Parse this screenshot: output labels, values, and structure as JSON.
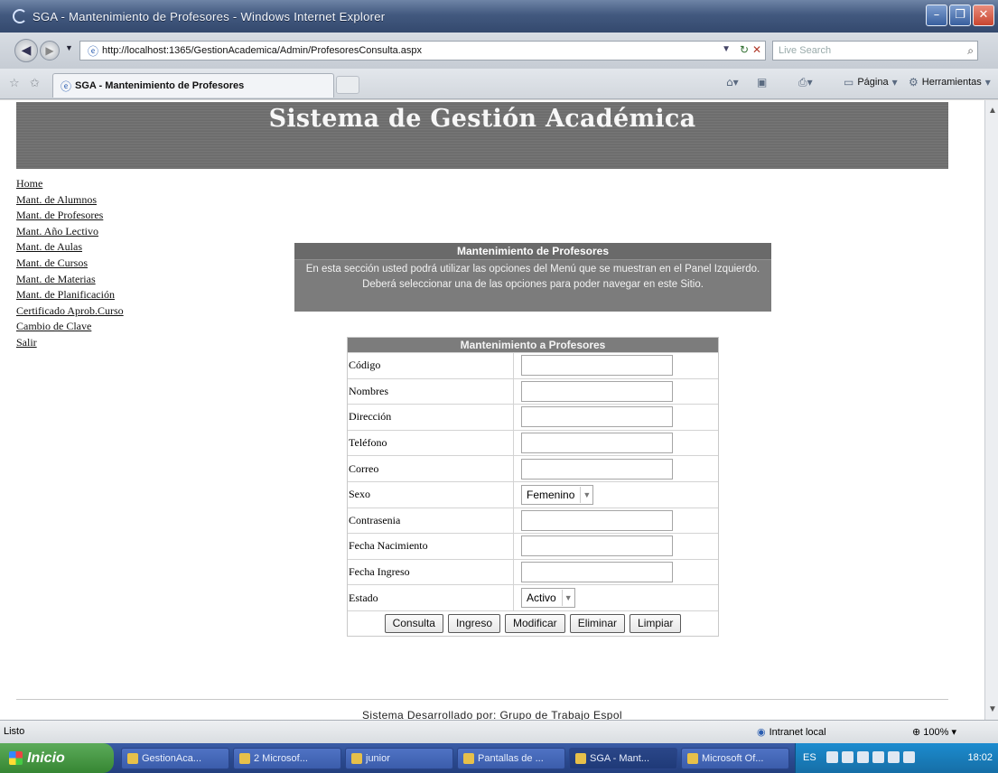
{
  "window": {
    "title": "SGA - Mantenimiento de Profesores - Windows Internet Explorer",
    "controls": [
      "minimize",
      "maximize",
      "close"
    ]
  },
  "address_bar": {
    "url": "http://localhost:1365/GestionAcademica/Admin/ProfesoresConsulta.aspx",
    "search_placeholder": "Live Search"
  },
  "tab_bar": {
    "active_tab": "SGA - Mantenimiento de Profesores",
    "commands": {
      "pagina": "Página",
      "herramientas": "Herramientas"
    }
  },
  "page": {
    "header_title": "Sistema de Gestión Académica",
    "menu": [
      "Home",
      "Mant. de Alumnos",
      "Mant. de Profesores",
      "Mant. Año Lectivo",
      "Mant. de Aulas",
      "Mant. de Cursos",
      "Mant. de Materias",
      "Mant. de Planificación",
      "Certificado Aprob.Curso",
      "Cambio de Clave",
      "Salir"
    ],
    "info_box": {
      "title": "Mantenimiento de Profesores",
      "text": "En esta sección usted podrá utilizar las opciones del Menú que se muestran en el Panel Izquierdo. Deberá seleccionar una de las opciones para poder navegar en este Sitio."
    },
    "form": {
      "title": "Mantenimiento a Profesores",
      "fields": {
        "codigo": {
          "label": "Código",
          "value": ""
        },
        "nombres": {
          "label": "Nombres",
          "value": ""
        },
        "direccion": {
          "label": "Dirección",
          "value": ""
        },
        "telefono": {
          "label": "Teléfono",
          "value": ""
        },
        "correo": {
          "label": "Correo",
          "value": ""
        },
        "sexo": {
          "label": "Sexo",
          "selected": "Femenino"
        },
        "contrasenia": {
          "label": "Contrasenia",
          "value": ""
        },
        "fecha_nacimiento": {
          "label": "Fecha Nacimiento",
          "value": ""
        },
        "fecha_ingreso": {
          "label": "Fecha Ingreso",
          "value": ""
        },
        "estado": {
          "label": "Estado",
          "selected": "Activo"
        }
      },
      "buttons": {
        "consulta": "Consulta",
        "ingreso": "Ingreso",
        "modificar": "Modificar",
        "eliminar": "Eliminar",
        "limpiar": "Limpiar"
      }
    },
    "footer": "Sistema Desarrollado por: Grupo de Trabajo Espol"
  },
  "status_bar": {
    "status": "Listo",
    "zone": "Intranet local",
    "zoom": "100%"
  },
  "taskbar": {
    "start": "Inicio",
    "tasks": [
      "GestionAca...",
      "2 Microsof...",
      "junior",
      "Pantallas de ...",
      "SGA - Mant...",
      "Microsoft Of..."
    ],
    "language": "ES",
    "clock": "18:02"
  },
  "colors": {
    "banner": "#6b6b6b",
    "section_header": "#7c7c7c",
    "titlebar": "#42597f",
    "taskbar": "#2b4b91",
    "start_button": "#368633"
  }
}
